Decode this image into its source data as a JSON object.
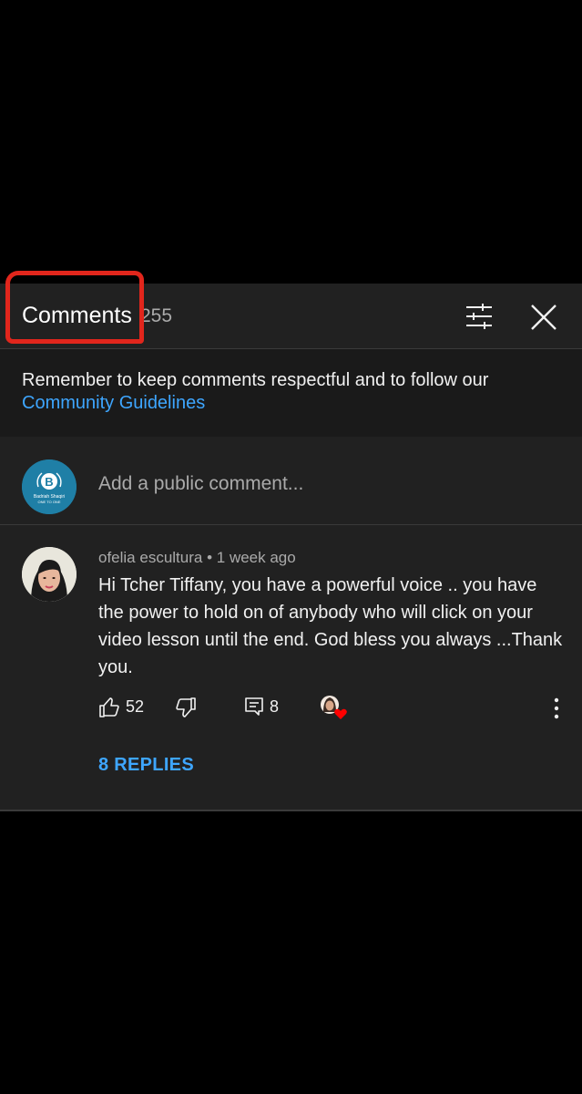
{
  "header": {
    "title": "Comments",
    "count": "255"
  },
  "guidelines": {
    "text": "Remember to keep comments respectful and to follow our",
    "link": "Community Guidelines"
  },
  "add_comment": {
    "placeholder": "Add a public comment...",
    "avatar_label": "Badriah Shaqiri",
    "avatar_sub": "ONE TO ONE",
    "avatar_letter": "B"
  },
  "comment": {
    "author": "ofelia escultura",
    "separator": "•",
    "time": "1 week ago",
    "text": "Hi Tcher Tiffany, you have a powerful voice .. you have the power to hold on of anybody who will click on your video lesson until the end. God bless you always ...Thank you.",
    "likes": "52",
    "replies_count": "8",
    "replies_label": "8 REPLIES"
  },
  "colors": {
    "accent_blue": "#3ea6ff",
    "panel": "#212121",
    "annotation_red": "#e1261c",
    "heart_red": "#ff0000"
  },
  "icons": [
    "filter-icon",
    "close-icon",
    "thumbs-up-icon",
    "thumbs-down-icon",
    "reply-icon",
    "creator-heart-icon",
    "more-vert-icon"
  ]
}
